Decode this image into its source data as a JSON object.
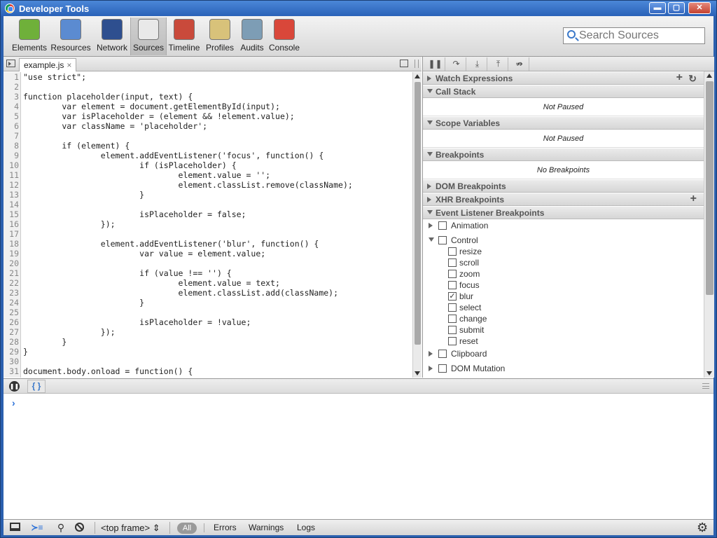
{
  "window": {
    "title": "Developer Tools",
    "minimize": "▬",
    "maximize": "▢",
    "close": "✕"
  },
  "toolbar": {
    "tools": [
      {
        "label": "Elements",
        "icon": "elements-icon",
        "color": "#6fb03a"
      },
      {
        "label": "Resources",
        "icon": "resources-icon",
        "color": "#5b8bd1"
      },
      {
        "label": "Network",
        "icon": "network-icon",
        "color": "#2e4f8f"
      },
      {
        "label": "Sources",
        "icon": "sources-icon",
        "color": "#e9e9e9"
      },
      {
        "label": "Timeline",
        "icon": "timeline-icon",
        "color": "#c94a3b"
      },
      {
        "label": "Profiles",
        "icon": "profiles-icon",
        "color": "#d8c27a"
      },
      {
        "label": "Audits",
        "icon": "audits-icon",
        "color": "#7d9db5"
      },
      {
        "label": "Console",
        "icon": "console-icon",
        "color": "#d9473a"
      }
    ],
    "active": "Sources",
    "search_placeholder": "Search Sources"
  },
  "editor": {
    "file_tab": "example.js",
    "close": "×",
    "lines": [
      {
        "n": "1",
        "t": "\"use strict\";"
      },
      {
        "n": "2",
        "t": ""
      },
      {
        "n": "3",
        "t": "function placeholder(input, text) {"
      },
      {
        "n": "4",
        "t": "        var element = document.getElementById(input);"
      },
      {
        "n": "5",
        "t": "        var isPlaceholder = (element && !element.value);"
      },
      {
        "n": "6",
        "t": "        var className = 'placeholder';"
      },
      {
        "n": "7",
        "t": ""
      },
      {
        "n": "8",
        "t": "        if (element) {"
      },
      {
        "n": "9",
        "t": "                element.addEventListener('focus', function() {"
      },
      {
        "n": "10",
        "t": "                        if (isPlaceholder) {"
      },
      {
        "n": "11",
        "t": "                                element.value = '';"
      },
      {
        "n": "12",
        "t": "                                element.classList.remove(className);"
      },
      {
        "n": "13",
        "t": "                        }"
      },
      {
        "n": "14",
        "t": ""
      },
      {
        "n": "15",
        "t": "                        isPlaceholder = false;"
      },
      {
        "n": "16",
        "t": "                });"
      },
      {
        "n": "17",
        "t": ""
      },
      {
        "n": "18",
        "t": "                element.addEventListener('blur', function() {"
      },
      {
        "n": "19",
        "t": "                        var value = element.value;"
      },
      {
        "n": "20",
        "t": ""
      },
      {
        "n": "21",
        "t": "                        if (value !== '') {"
      },
      {
        "n": "22",
        "t": "                                element.value = text;"
      },
      {
        "n": "23",
        "t": "                                element.classList.add(className);"
      },
      {
        "n": "24",
        "t": "                        }"
      },
      {
        "n": "25",
        "t": ""
      },
      {
        "n": "26",
        "t": "                        isPlaceholder = !value;"
      },
      {
        "n": "27",
        "t": "                });"
      },
      {
        "n": "28",
        "t": "        }"
      },
      {
        "n": "29",
        "t": "}"
      },
      {
        "n": "30",
        "t": ""
      },
      {
        "n": "31",
        "t": "document.body.onload = function() {"
      }
    ]
  },
  "debugger": {
    "buttons": [
      "pause-icon",
      "step-over-icon",
      "step-into-icon",
      "step-out-icon",
      "deactivate-breakpoints-icon"
    ],
    "panes": {
      "watch": {
        "title": "Watch Expressions",
        "add": "+",
        "refresh": "↻"
      },
      "callstack": {
        "title": "Call Stack",
        "body": "Not Paused"
      },
      "scope": {
        "title": "Scope Variables",
        "body": "Not Paused"
      },
      "breakpoints": {
        "title": "Breakpoints",
        "body": "No Breakpoints"
      },
      "dom": {
        "title": "DOM Breakpoints"
      },
      "xhr": {
        "title": "XHR Breakpoints",
        "add": "+"
      },
      "events": {
        "title": "Event Listener Breakpoints"
      }
    },
    "event_categories": [
      {
        "label": "Animation",
        "expanded": false,
        "checked": false
      },
      {
        "label": "Control",
        "expanded": true,
        "checked": false
      },
      {
        "label": "Clipboard",
        "expanded": false,
        "checked": false
      },
      {
        "label": "DOM Mutation",
        "expanded": false,
        "checked": false
      }
    ],
    "control_events": [
      {
        "label": "resize",
        "checked": false
      },
      {
        "label": "scroll",
        "checked": false
      },
      {
        "label": "zoom",
        "checked": false
      },
      {
        "label": "focus",
        "checked": false
      },
      {
        "label": "blur",
        "checked": true
      },
      {
        "label": "select",
        "checked": false
      },
      {
        "label": "change",
        "checked": false
      },
      {
        "label": "submit",
        "checked": false
      },
      {
        "label": "reset",
        "checked": false
      }
    ]
  },
  "drawer": {
    "pretty_print": "{ }"
  },
  "console": {
    "prompt": "›"
  },
  "statusbar": {
    "frame": "<top frame>",
    "frame_arrow": "⇕",
    "all": "All",
    "filters": [
      "Errors",
      "Warnings",
      "Logs"
    ],
    "gear": "⚙"
  }
}
